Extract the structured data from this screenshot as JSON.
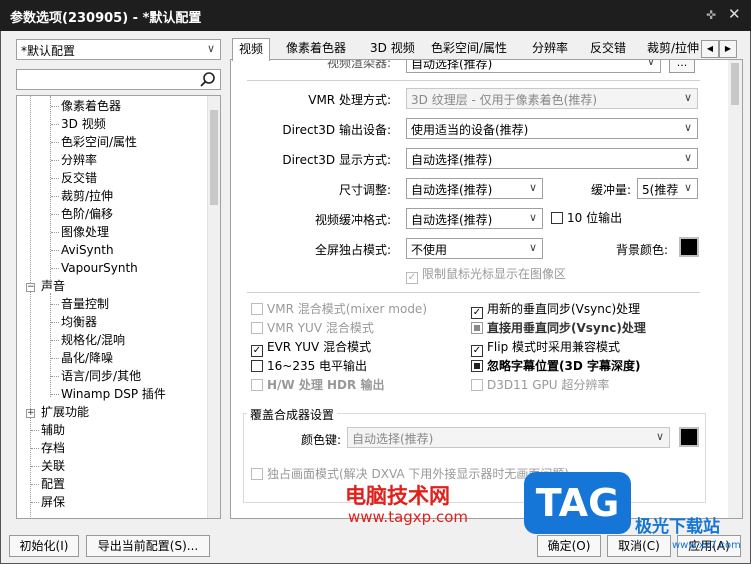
{
  "window": {
    "title": "参数选项(230905) - *默认配置",
    "pin_icon": "pin-icon",
    "close_icon": "close-icon"
  },
  "profile": {
    "selected": "*默认配置"
  },
  "search": {
    "value": "",
    "icon": "search-icon"
  },
  "tree": {
    "items": [
      {
        "label": "像素着色器"
      },
      {
        "label": "3D 视频"
      },
      {
        "label": "色彩空间/属性"
      },
      {
        "label": "分辨率"
      },
      {
        "label": "反交错"
      },
      {
        "label": "裁剪/拉伸"
      },
      {
        "label": "色阶/偏移"
      },
      {
        "label": "图像处理"
      },
      {
        "label": "AviSynth"
      },
      {
        "label": "VapourSynth"
      },
      {
        "label": "声音"
      },
      {
        "label": "音量控制"
      },
      {
        "label": "均衡器"
      },
      {
        "label": "规格化/混响"
      },
      {
        "label": "晶化/降噪"
      },
      {
        "label": "语言/同步/其他"
      },
      {
        "label": "Winamp DSP 插件"
      },
      {
        "label": "扩展功能"
      },
      {
        "label": "辅助"
      },
      {
        "label": "存档"
      },
      {
        "label": "关联"
      },
      {
        "label": "配置"
      },
      {
        "label": "屏保"
      }
    ]
  },
  "tabs": [
    {
      "label": "视频",
      "active": true
    },
    {
      "label": "像素着色器"
    },
    {
      "label": "3D 视频"
    },
    {
      "label": "色彩空间/属性"
    },
    {
      "label": "分辨率"
    },
    {
      "label": "反交错"
    },
    {
      "label": "裁剪/拉伸"
    }
  ],
  "video": {
    "top_partial": {
      "label": "视频渲染器:",
      "value": "自动选择(推荐)",
      "btn": "..."
    },
    "vmr_mode": {
      "label": "VMR 处理方式:",
      "value": "3D 纹理层 - 仅用于像素着色(推荐)"
    },
    "d3d_device": {
      "label": "Direct3D 输出设备:",
      "value": "使用适当的设备(推荐)"
    },
    "d3d_display": {
      "label": "Direct3D 显示方式:",
      "value": "自动选择(推荐)"
    },
    "resize": {
      "label": "尺寸调整:",
      "value": "自动选择(推荐)"
    },
    "buffer": {
      "label": "缓冲量:",
      "value": "5(推荐"
    },
    "buffer_format": {
      "label": "视频缓冲格式:",
      "value": "自动选择(推荐)"
    },
    "ten_bit": {
      "label": "10 位输出"
    },
    "fullscreen": {
      "label": "全屏独占模式:",
      "value": "不使用"
    },
    "bg_color": {
      "label": "背景颜色:",
      "color": "#000000"
    },
    "limit_cursor": {
      "label": "限制鼠标光标显示在图像区"
    },
    "checks": [
      {
        "label": "VMR 混合模式(mixer mode)",
        "state": "disabled"
      },
      {
        "label": "用新的垂直同步(Vsync)处理",
        "state": "checked"
      },
      {
        "label": "VMR YUV 混合模式",
        "state": "disabled"
      },
      {
        "label": "直接用垂直同步(Vsync)处理",
        "state": "indeterminate"
      },
      {
        "label": "EVR YUV 混合模式",
        "state": "checked"
      },
      {
        "label": "Flip 模式时采用兼容模式",
        "state": "checked"
      },
      {
        "label": "16~235 电平输出",
        "state": "unchecked"
      },
      {
        "label": "忽略字幕位置(3D 字幕深度)",
        "state": "indeterminate"
      },
      {
        "label": "H/W 处理 HDR 输出",
        "state": "disabled"
      },
      {
        "label": "D3D11 GPU 超分辨率",
        "state": "disabled"
      }
    ],
    "overlay": {
      "group_title": "覆盖合成器设置",
      "color_key_label": "颜色键:",
      "color_key_value": "自动选择(推荐)",
      "color_key_swatch": "#000000",
      "exclusive": "独占画面模式(解决 DXVA 下用外接显示器时无画面问题)"
    }
  },
  "footer": {
    "init": "初始化(I)",
    "export": "导出当前配置(S)...",
    "ok": "确定(O)",
    "cancel": "取消(C)",
    "apply": "应用(A)"
  },
  "watermark": {
    "text": "电脑技术网",
    "url": "www.tagxp.com",
    "logo": "TAG",
    "site": "极光下载站",
    "site_url": "www.xz7.com"
  }
}
